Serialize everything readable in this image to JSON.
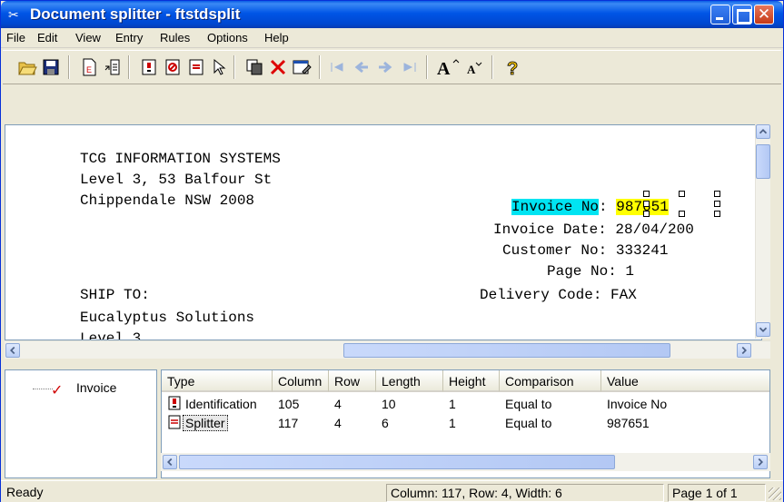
{
  "window": {
    "title": "Document splitter - ftstdsplit",
    "close_glyph": "✕"
  },
  "menu": [
    {
      "label": "File"
    },
    {
      "label": "Edit"
    },
    {
      "label": "View"
    },
    {
      "label": "Entry"
    },
    {
      "label": "Rules"
    },
    {
      "label": "Options"
    },
    {
      "label": "Help"
    }
  ],
  "toolbar": {
    "icons": [
      "open-folder-icon",
      "save-disk-icon",
      "identification-icon",
      "field-icon",
      "identification-rule-icon",
      "exclusion-icon",
      "splitter-icon",
      "pointer-icon",
      "copy-icon",
      "delete-icon",
      "properties-icon",
      "first-page-icon",
      "previous-page-icon",
      "next-page-icon",
      "last-page-icon",
      "increase-font-icon",
      "decrease-font-icon",
      "help-icon"
    ]
  },
  "document": {
    "lines": {
      "l1": "TCG INFORMATION SYSTEMS",
      "l2": "Level 3, 53 Balfour St",
      "l3": "Chippendale NSW 2008",
      "invoice_label": "Invoice No",
      "colon": ":",
      "invoice_value": "987651",
      "date": "Invoice Date: 28/04/200",
      "customer": "Customer No: 333241",
      "page": "Page No: 1",
      "ship_to": "SHIP TO:",
      "delivery": "Delivery Code: FAX",
      "company": "Eucalyptus Solutions",
      "partial": "Level 3"
    }
  },
  "tree": {
    "item": "Invoice"
  },
  "grid": {
    "headers": [
      "Type",
      "Column",
      "Row",
      "Length",
      "Height",
      "Comparison",
      "Value"
    ],
    "rows": [
      {
        "type": "Identification",
        "column": "105",
        "row": "4",
        "length": "10",
        "height": "1",
        "comparison": "Equal to",
        "value": "Invoice No"
      },
      {
        "type": "Splitter",
        "column": "117",
        "row": "4",
        "length": "6",
        "height": "1",
        "comparison": "Equal to",
        "value": "987651"
      }
    ]
  },
  "status": {
    "state": "Ready",
    "position": "Column: 117, Row: 4, Width: 6",
    "page": "Page 1 of 1"
  }
}
